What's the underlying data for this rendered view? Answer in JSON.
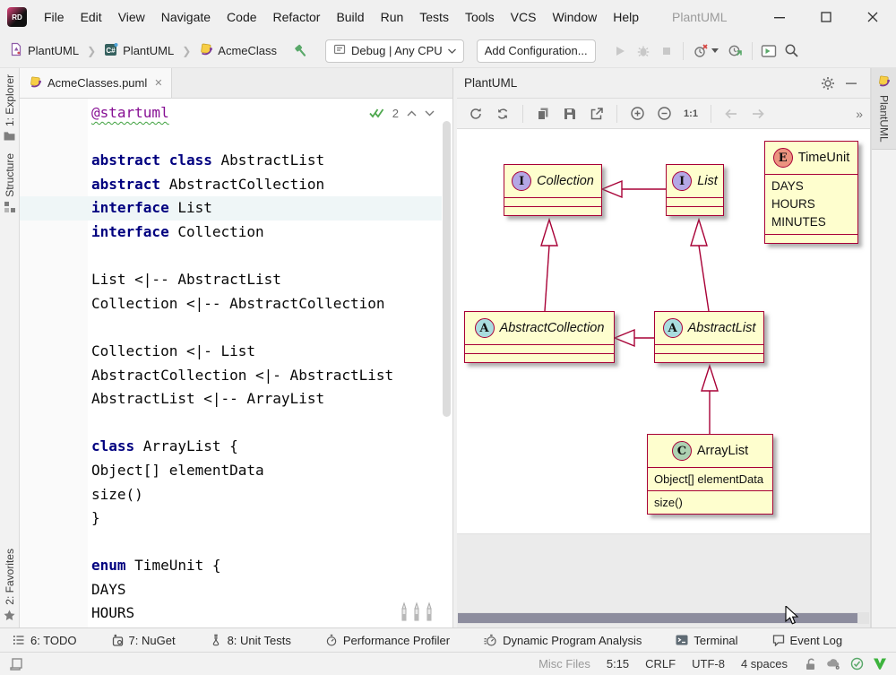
{
  "window": {
    "title": "PlantUML"
  },
  "menu_bar": {
    "items": [
      "File",
      "Edit",
      "View",
      "Navigate",
      "Code",
      "Refactor",
      "Build",
      "Run",
      "Tests",
      "Tools",
      "VCS",
      "Window",
      "Help"
    ]
  },
  "toolbar": {
    "breadcrumb": {
      "solution": "PlantUML",
      "project": "PlantUML",
      "file": "AcmeClass"
    },
    "run_config_label": "Debug | Any CPU",
    "add_config_label": "Add Configuration..."
  },
  "left_bar": {
    "explorer": "1: Explorer",
    "structure": "Structure",
    "favorites": "2: Favorites"
  },
  "right_bar": {
    "plantuml": "PlantUML"
  },
  "editor": {
    "tab_title": "AcmeClasses.puml",
    "inspections_count": "2",
    "current_line": 5,
    "code_lines": [
      [
        [
          "@startuml",
          "meta"
        ]
      ],
      [],
      [
        [
          "abstract class ",
          "kw"
        ],
        [
          "AbstractList",
          "pl"
        ]
      ],
      [
        [
          "abstract ",
          "kw"
        ],
        [
          "AbstractCollection",
          "pl"
        ]
      ],
      [
        [
          "interface ",
          "kw"
        ],
        [
          "List",
          "pl"
        ]
      ],
      [
        [
          "interface ",
          "kw"
        ],
        [
          "Collection",
          "pl"
        ]
      ],
      [],
      [
        [
          "List <|-- AbstractList",
          "pl"
        ]
      ],
      [
        [
          "Collection <|-- AbstractCollection",
          "pl"
        ]
      ],
      [],
      [
        [
          "Collection <|- List",
          "pl"
        ]
      ],
      [
        [
          "AbstractCollection <|- AbstractList",
          "pl"
        ]
      ],
      [
        [
          "AbstractList <|-- ArrayList",
          "pl"
        ]
      ],
      [],
      [
        [
          "class ",
          "kw"
        ],
        [
          "ArrayList {",
          "pl"
        ]
      ],
      [
        [
          "Object[] elementData",
          "pl"
        ]
      ],
      [
        [
          "size()",
          "pl"
        ]
      ],
      [
        [
          "}",
          "pl"
        ]
      ],
      [],
      [
        [
          "enum ",
          "kw"
        ],
        [
          "TimeUnit {",
          "pl"
        ]
      ],
      [
        [
          "DAYS",
          "pl"
        ]
      ],
      [
        [
          "HOURS",
          "pl"
        ]
      ]
    ]
  },
  "panel": {
    "title": "PlantUML",
    "zoom_label": "1:1"
  },
  "diagram": {
    "classes": [
      {
        "name": "Collection",
        "letter": "I"
      },
      {
        "name": "List",
        "letter": "I"
      },
      {
        "name": "TimeUnit",
        "letter": "E",
        "members": [
          "DAYS",
          "HOURS",
          "MINUTES"
        ]
      },
      {
        "name": "AbstractCollection",
        "letter": "A"
      },
      {
        "name": "AbstractList",
        "letter": "A"
      },
      {
        "name": "ArrayList",
        "letter": "C",
        "fields": [
          "Object[] elementData"
        ],
        "methods": [
          "size()"
        ]
      }
    ],
    "colors": {
      "border": "#A80036",
      "fill": "#FEFECE",
      "interface_circle": "#B4A7E5",
      "abstract_circle": "#A9DCDF",
      "class_circle": "#ADD1B2",
      "enum_circle": "#EB937F"
    }
  },
  "bottom_bar": {
    "items": [
      "6: TODO",
      "7: NuGet",
      "8: Unit Tests",
      "Performance Profiler",
      "Dynamic Program Analysis",
      "Terminal",
      "Event Log"
    ]
  },
  "status_bar": {
    "context": "Misc Files",
    "caret": "5:15",
    "line_sep": "CRLF",
    "encoding": "UTF-8",
    "indent": "4 spaces"
  }
}
